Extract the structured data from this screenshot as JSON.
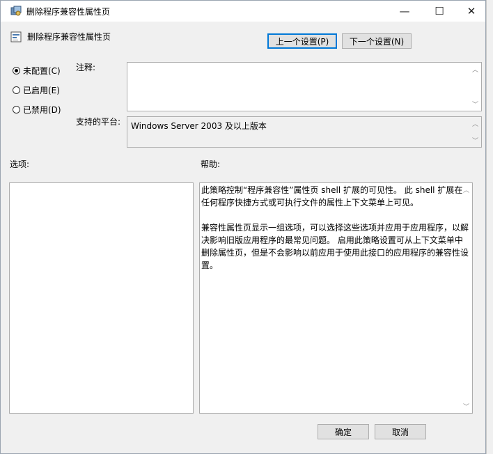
{
  "window": {
    "title": "删除程序兼容性属性页",
    "minimize_glyph": "—",
    "maximize_glyph": "☐",
    "close_glyph": "✕"
  },
  "header": {
    "policy_name": "删除程序兼容性属性页"
  },
  "nav": {
    "prev_label": "上一个设置(P)",
    "next_label": "下一个设置(N)"
  },
  "state": {
    "options": [
      {
        "label": "未配置(C)",
        "selected": true
      },
      {
        "label": "已启用(E)",
        "selected": false
      },
      {
        "label": "已禁用(D)",
        "selected": false
      }
    ]
  },
  "comment": {
    "label": "注释:",
    "value": ""
  },
  "platform": {
    "label": "支持的平台:",
    "value": "Windows Server 2003 及以上版本"
  },
  "options_panel": {
    "label": "选项:"
  },
  "help_panel": {
    "label": "帮助:",
    "paragraphs": [
      "此策略控制“程序兼容性”属性页 shell 扩展的可见性。 此 shell 扩展在任何程序快捷方式或可执行文件的属性上下文菜单上可见。",
      "兼容性属性页显示一组选项，可以选择这些选项并应用于应用程序，以解决影响旧版应用程序的最常见问题。 启用此策略设置可从上下文菜单中删除属性页，但是不会影响以前应用于使用此接口的应用程序的兼容性设置。"
    ]
  },
  "footer": {
    "ok_label": "确定",
    "cancel_label": "取消"
  },
  "colors": {
    "window_bg": "#f0f0f0",
    "focus_border": "#0078d7",
    "titlebar_bg": "#ffffff"
  }
}
